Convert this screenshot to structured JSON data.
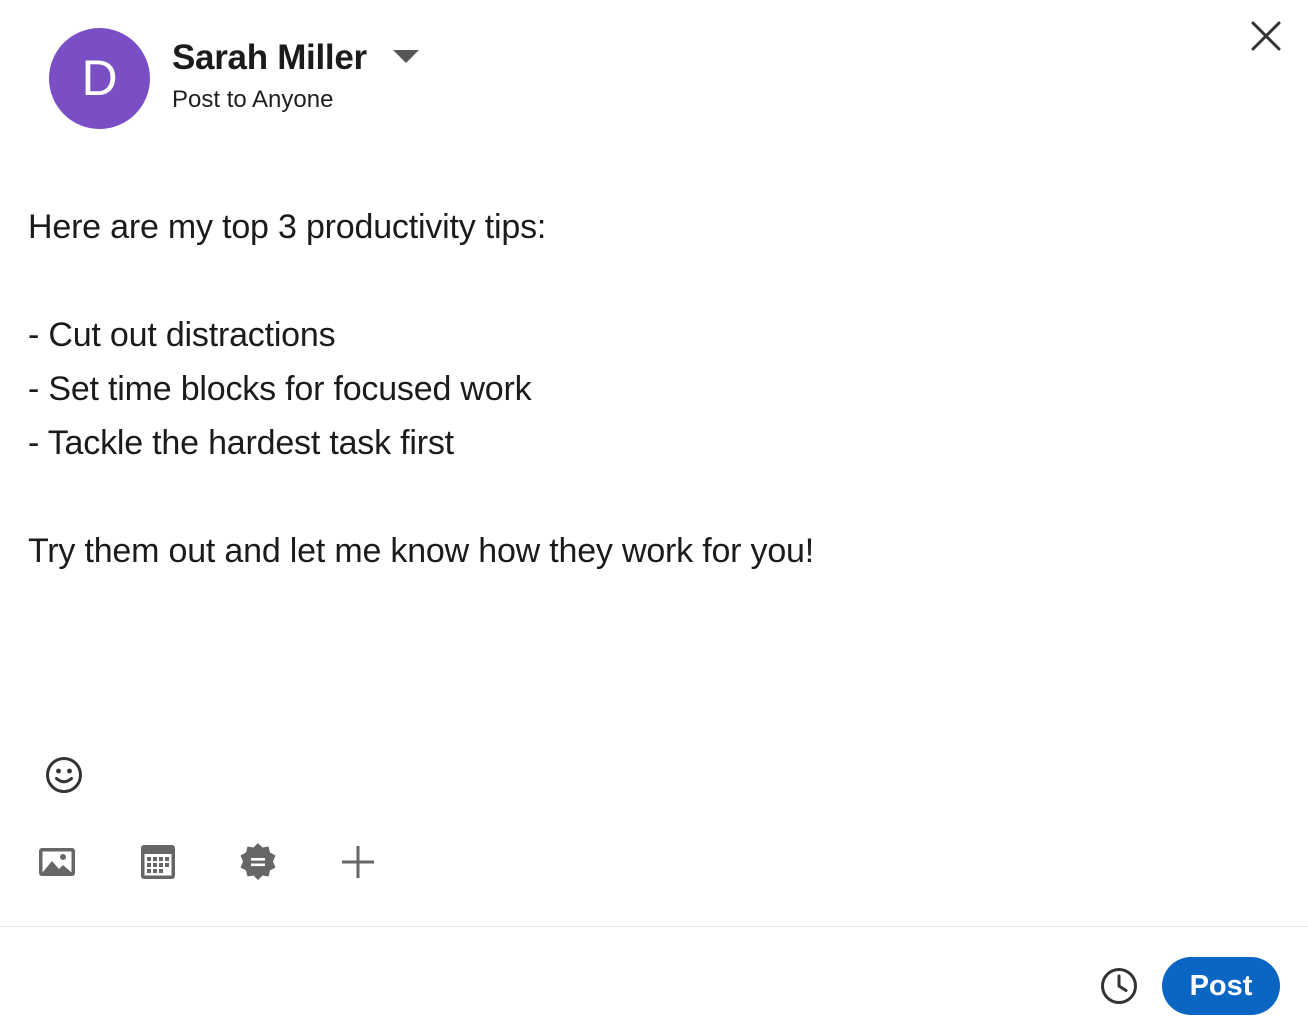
{
  "header": {
    "avatar_initial": "D",
    "avatar_color": "#7a4fc6",
    "author_name": "Sarah Miller",
    "audience": "Post to Anyone",
    "close_icon": "close-icon"
  },
  "post": {
    "lines": [
      "Here are my top 3 productivity tips:",
      "",
      "- Cut out distractions",
      "- Set time blocks for focused work",
      "- Tackle the hardest task first",
      "",
      "Try them out and let me know how they work for you!"
    ]
  },
  "toolbar": {
    "emoji_icon": "emoji-smile-icon",
    "tools": [
      {
        "name": "add-media-button",
        "icon": "image-icon"
      },
      {
        "name": "create-event-button",
        "icon": "calendar-icon"
      },
      {
        "name": "celebrate-badge-button",
        "icon": "badge-icon"
      },
      {
        "name": "more-options-button",
        "icon": "plus-icon"
      }
    ]
  },
  "footer": {
    "schedule_icon": "clock-icon",
    "post_label": "Post",
    "post_color": "#0a66c2"
  }
}
